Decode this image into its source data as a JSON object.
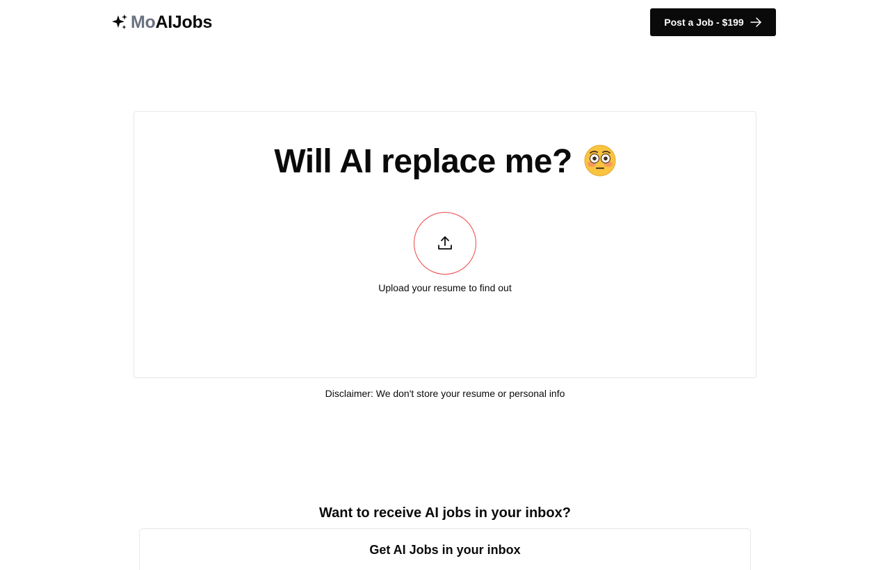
{
  "header": {
    "logo_part1": "Mo",
    "logo_part2": "AIJobs",
    "logo_icon": "sparkles-icon",
    "post_job_label": "Post a Job - $199",
    "post_job_icon": "arrow-right-icon"
  },
  "hero": {
    "title": "Will AI replace me?",
    "emoji_icon": "flushed-face-emoji",
    "upload_icon": "upload-icon",
    "upload_label": "Upload your resume to find out",
    "upload_circle_border_color": "#ef4444"
  },
  "disclaimer": "Disclaimer: We don't store your resume or personal info",
  "newsletter": {
    "heading": "Want to receive AI jobs in your inbox?",
    "card_title": "Get AI Jobs in your inbox"
  },
  "colors": {
    "primary": "#0a0a0a",
    "muted": "#6b7280",
    "border": "#e5e7eb",
    "accent": "#ef4444"
  }
}
